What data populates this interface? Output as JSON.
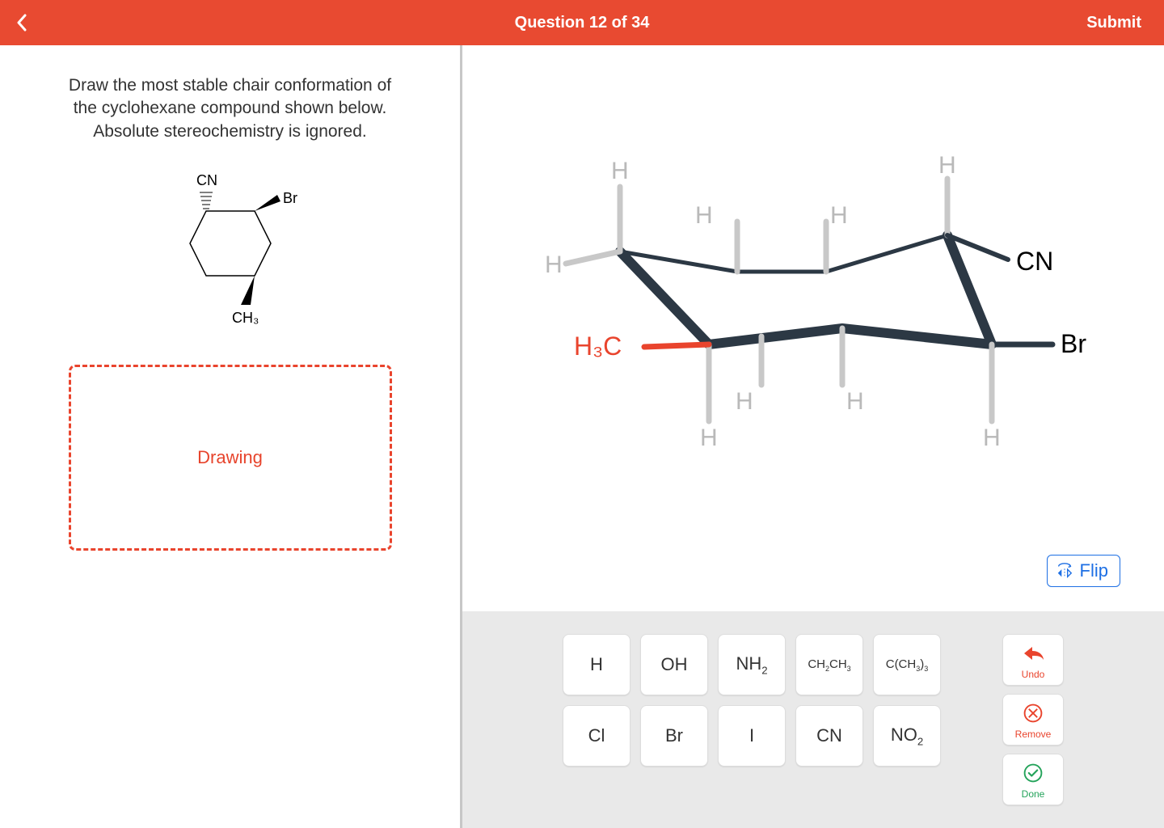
{
  "header": {
    "title": "Question 12 of 34",
    "submit": "Submit"
  },
  "prompt": {
    "text": "Draw the most stable chair conformation of the cyclohexane compound shown below. Absolute stereochemistry is ignored.",
    "structure": {
      "top_substituent": "CN",
      "right_substituent": "Br",
      "bottom_substituent": "CH₃"
    },
    "drawing_box_label": "Drawing"
  },
  "canvas": {
    "substituents": {
      "eq_top_right": "CN",
      "eq_bottom_right": "Br",
      "eq_bottom_left": "H₃C",
      "eq_top_left": "H",
      "ax_top_left": "H",
      "ax_back_left": "H",
      "ax_back_right": "H",
      "ax_top_right": "H",
      "ax_front_left_down": "H",
      "ax_front_mid_left": "H",
      "ax_front_mid_right": "H",
      "ax_front_right_down": "H"
    },
    "selected_substituent": "H₃C",
    "flip_label": "Flip"
  },
  "tools": {
    "substituents_row1": [
      "H",
      "OH",
      "NH₂",
      "CH₂CH₃",
      "C(CH₃)₃"
    ],
    "substituents_row2": [
      "Cl",
      "Br",
      "I",
      "CN",
      "NO₂"
    ],
    "actions": {
      "undo": "Undo",
      "remove": "Remove",
      "done": "Done"
    }
  }
}
